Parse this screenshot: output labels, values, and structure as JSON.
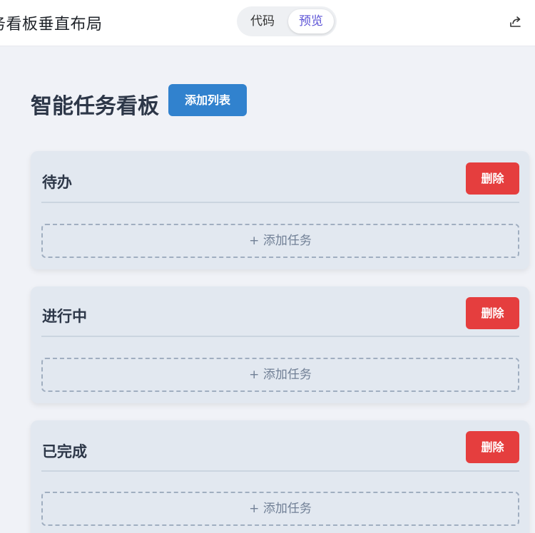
{
  "topbar": {
    "title": "务看板垂直布局",
    "tabs": {
      "code": "代码",
      "preview": "预览"
    },
    "share_icon": "share-icon"
  },
  "main": {
    "title": "智能任务看板",
    "add_list_label": "添加列表"
  },
  "columns": [
    {
      "title": "待办",
      "delete_label": "删除",
      "add_task_label": "+ 添加任务"
    },
    {
      "title": "进行中",
      "delete_label": "删除",
      "add_task_label": "+ 添加任务"
    },
    {
      "title": "已完成",
      "delete_label": "删除",
      "add_task_label": "+ 添加任务"
    }
  ],
  "colors": {
    "primary": "#3182ce",
    "danger": "#e53e3e",
    "column_bg": "#e2e8f0",
    "page_bg": "#f0f2f7",
    "tab_active": "#5b52d6"
  }
}
